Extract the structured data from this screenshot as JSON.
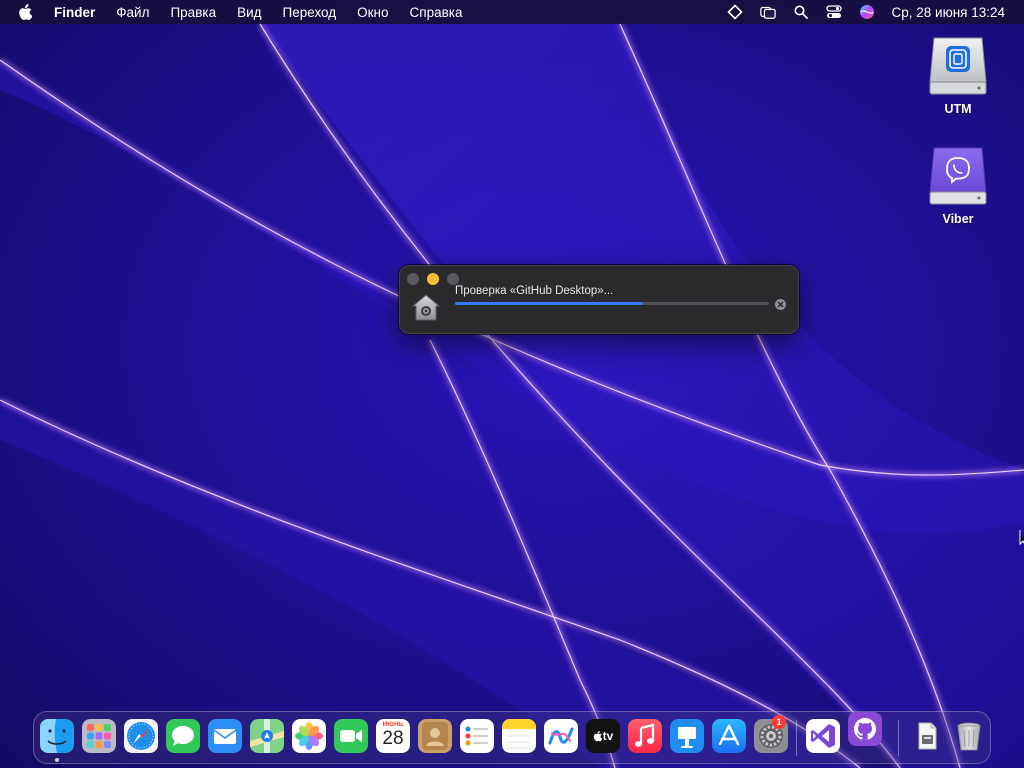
{
  "menubar": {
    "app_name": "Finder",
    "menus": [
      "Файл",
      "Правка",
      "Вид",
      "Переход",
      "Окно",
      "Справка"
    ],
    "status_icons": [
      "diamond-icon",
      "window-stack-icon",
      "search-icon",
      "control-center-icon",
      "siri-icon"
    ],
    "clock": "Ср, 28 июня  13:24"
  },
  "desktop": {
    "icons": [
      {
        "label": "UTM",
        "icon": "utm-disk-icon"
      },
      {
        "label": "Viber",
        "icon": "viber-disk-icon"
      }
    ]
  },
  "dialog": {
    "title": "Проверка «GitHub Desktop»...",
    "progress": 0.6,
    "icon": "gatekeeper-house-icon"
  },
  "dock": {
    "apps": [
      {
        "name": "Finder",
        "icon": "finder-icon",
        "running": true
      },
      {
        "name": "Launchpad",
        "icon": "launchpad-icon"
      },
      {
        "name": "Safari",
        "icon": "safari-icon"
      },
      {
        "name": "Messages",
        "icon": "messages-icon"
      },
      {
        "name": "Mail",
        "icon": "mail-icon"
      },
      {
        "name": "Maps",
        "icon": "maps-icon"
      },
      {
        "name": "Photos",
        "icon": "photos-icon"
      },
      {
        "name": "FaceTime",
        "icon": "facetime-icon"
      },
      {
        "name": "Calendar",
        "icon": "calendar-icon",
        "month": "ИЮНЬ",
        "day": "28"
      },
      {
        "name": "Contacts",
        "icon": "contacts-icon"
      },
      {
        "name": "Reminders",
        "icon": "reminders-icon"
      },
      {
        "name": "Notes",
        "icon": "notes-icon"
      },
      {
        "name": "Freeform",
        "icon": "freeform-icon"
      },
      {
        "name": "TV",
        "icon": "tv-icon",
        "text": "tv"
      },
      {
        "name": "Music",
        "icon": "music-icon"
      },
      {
        "name": "Keynote",
        "icon": "keynote-icon"
      },
      {
        "name": "App Store",
        "icon": "app-store-icon"
      },
      {
        "name": "System Settings",
        "icon": "system-settings-icon",
        "badge": "1"
      }
    ],
    "recent": [
      {
        "name": "Visual Studio",
        "icon": "visual-studio-icon"
      },
      {
        "name": "GitHub Desktop",
        "icon": "github-desktop-icon"
      }
    ],
    "right": [
      {
        "name": "Downloads",
        "icon": "downloads-stack-icon"
      },
      {
        "name": "Trash",
        "icon": "trash-icon"
      }
    ]
  }
}
